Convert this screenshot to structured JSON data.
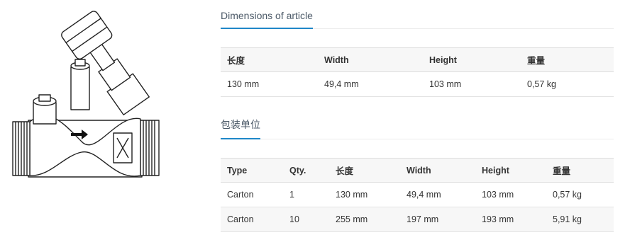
{
  "image": {
    "subject": "valve-drawing-icon"
  },
  "dimensions": {
    "title": "Dimensions of article",
    "headers": [
      "长度",
      "Width",
      "Height",
      "重量"
    ],
    "rows": [
      [
        "130 mm",
        "49,4 mm",
        "103 mm",
        "0,57 kg"
      ]
    ]
  },
  "packaging": {
    "title": "包装单位",
    "headers": [
      "Type",
      "Qty.",
      "长度",
      "Width",
      "Height",
      "重量"
    ],
    "rows": [
      [
        "Carton",
        "1",
        "130 mm",
        "49,4 mm",
        "103 mm",
        "0,57 kg"
      ],
      [
        "Carton",
        "10",
        "255 mm",
        "197 mm",
        "193 mm",
        "5,91 kg"
      ]
    ]
  }
}
